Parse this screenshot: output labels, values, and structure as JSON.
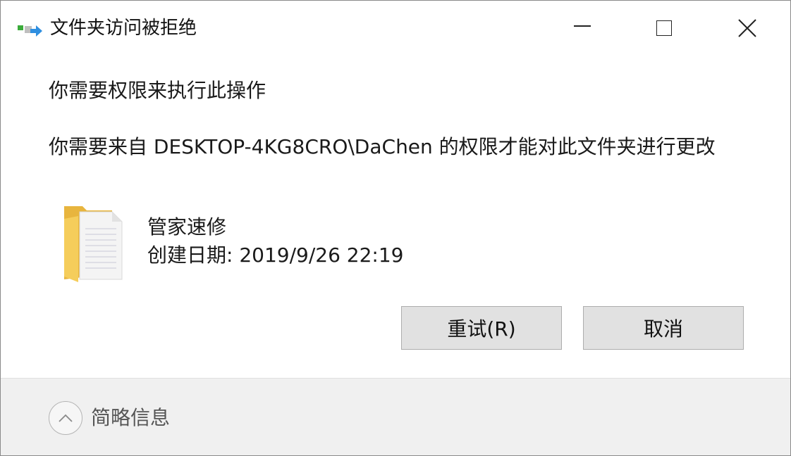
{
  "window": {
    "title": "文件夹访问被拒绝",
    "icon": "folder-access-arrow-icon",
    "controls": {
      "minimize": "minimize-icon",
      "maximize": "maximize-icon",
      "close": "close-icon"
    }
  },
  "content": {
    "heading": "你需要权限来执行此操作",
    "message": "你需要来自 DESKTOP-4KG8CRO\\DaChen 的权限才能对此文件夹进行更改",
    "item": {
      "icon": "folder-icon",
      "name": "管家速修",
      "date": "创建日期: 2019/9/26 22:19"
    },
    "buttons": {
      "retry": "重试(R)",
      "cancel": "取消"
    }
  },
  "footer": {
    "toggle_icon": "chevron-up-icon",
    "label": "简略信息"
  },
  "colors": {
    "button_bg": "#e1e1e1",
    "footer_bg": "#f0f0f0",
    "folder_yellow": "#f5cd5b",
    "arrow_blue": "#2f8fe0",
    "icon_green": "#3bab3b"
  }
}
